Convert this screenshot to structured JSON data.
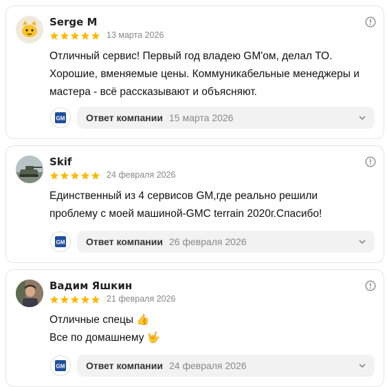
{
  "reviews": [
    {
      "author": "Serge M",
      "rating": 5,
      "date": "13 марта 2026",
      "text_lines": [
        "Отличный сервис! Первый год владею GM'ом, делал ТО.",
        "Хорошие, вменяемые цены. Коммуникабельные менеджеры и",
        "мастера - всё рассказывают и объясняют."
      ],
      "reply_label": "Ответ компании",
      "reply_date": "15 марта 2026",
      "avatar_icon": "cat-face-icon"
    },
    {
      "author": "Skif",
      "rating": 5,
      "date": "24 февраля 2026",
      "text_lines": [
        "Единственный из 4 сервисов GM,где реально решили",
        "проблему с моей машиной-GMC terrain 2020г.Спасибо!"
      ],
      "reply_label": "Ответ компании",
      "reply_date": "26 февраля 2026",
      "avatar_icon": "tank-photo"
    },
    {
      "author": "Вадим Яшкин",
      "rating": 5,
      "date": "21 февраля 2026",
      "text_lines": [
        "Отличные спецы 👍",
        "Все по домашнему 🤟"
      ],
      "reply_label": "Ответ компании",
      "reply_date": "24 февраля 2026",
      "avatar_icon": "person-photo"
    }
  ],
  "company_logo_text": "GM",
  "colors": {
    "star": "#fcb900",
    "border": "#e4e4e4",
    "reply_bg": "#f2f2f2",
    "gm_blue": "#1f4e9e"
  }
}
